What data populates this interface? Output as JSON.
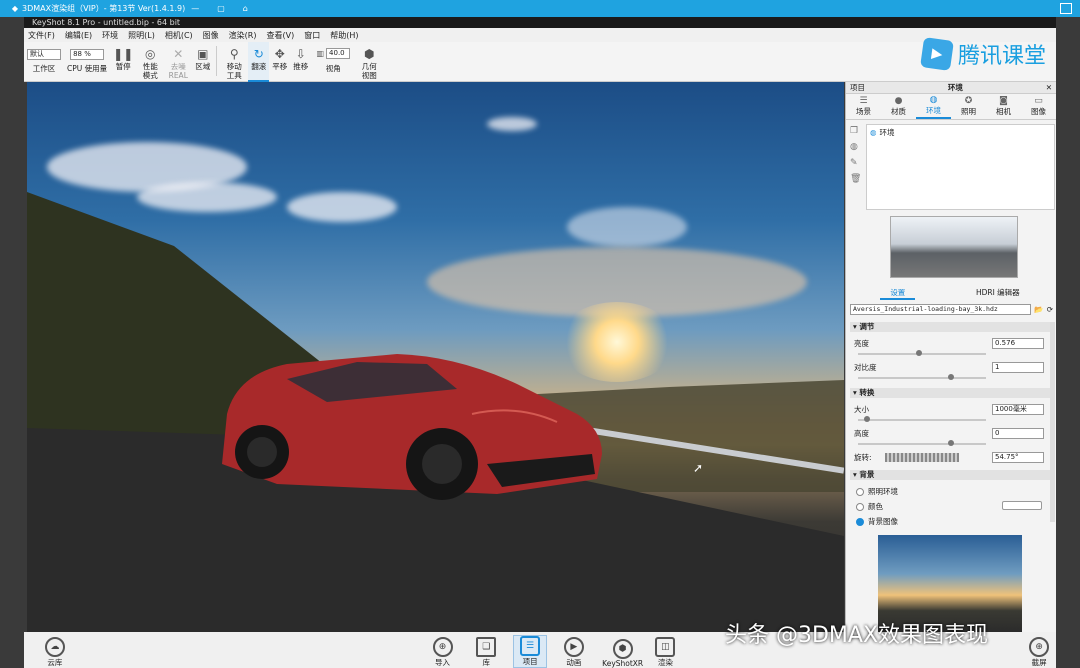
{
  "topstrip": {
    "title": "3DMAX渲染组（VIP）- 第13节 Ver(1.4.1.9)"
  },
  "window": {
    "title": "KeyShot 8.1 Pro - untitled.bip - 64 bit"
  },
  "menu": [
    "文件(F)",
    "编辑(E)",
    "环境",
    "照明(L)",
    "相机(C)",
    "图像",
    "渲染(R)",
    "查看(V)",
    "窗口",
    "帮助(H)"
  ],
  "toolbar": {
    "workspace_select": "默认",
    "workspace_label": "工作区",
    "cpu_select": "88 %",
    "cpu_label": "CPU 使用量",
    "pause": "暂停",
    "perf": "性能模式",
    "denoise": "去噪\nREAL",
    "region": "区域",
    "move_tool": "移动工具",
    "tumble": "翻滚",
    "pan": "平移",
    "dolly": "推移",
    "fov_value": "40.0",
    "fov_label": "视角",
    "geom": "几何视图"
  },
  "logo": {
    "text": "腾讯课堂"
  },
  "panel": {
    "left_title": "项目",
    "title": "环境",
    "tabs": [
      {
        "label": "场景",
        "icon": "list-icon"
      },
      {
        "label": "材质",
        "icon": "sphere-icon"
      },
      {
        "label": "环境",
        "icon": "globe-icon"
      },
      {
        "label": "照明",
        "icon": "bulb-icon"
      },
      {
        "label": "相机",
        "icon": "camera-icon"
      },
      {
        "label": "图像",
        "icon": "image-icon"
      }
    ],
    "env_item": "环境",
    "subtab_settings": "设置",
    "subtab_hdri": "HDRI 编辑器",
    "hdri_file": "Aversis_Industrial-loading-bay_3k.hdz",
    "sec_adjust": "调节",
    "brightness_label": "亮度",
    "brightness_value": "0.576",
    "brightness": 0.45,
    "contrast_label": "对比度",
    "contrast_value": "1",
    "contrast": 0.7,
    "sec_transform": "转换",
    "size_label": "大小",
    "size_value": "1000毫米",
    "size": 0.05,
    "height_label": "高度",
    "height_value": "0",
    "height": 0.7,
    "rotation_label": "旋转:",
    "rotation_value": "54.75°",
    "sec_background": "背景",
    "bg_options": [
      "照明环境",
      "颜色",
      "背景图像"
    ],
    "bg_selected": 2
  },
  "dock": [
    {
      "label": "云库",
      "icon": "cloud-icon"
    },
    {
      "label": "导入",
      "icon": "import-icon"
    },
    {
      "label": "库",
      "icon": "book-icon"
    },
    {
      "label": "项目",
      "icon": "project-icon"
    },
    {
      "label": "动画",
      "icon": "play-icon"
    },
    {
      "label": "KeyShotXR",
      "icon": "cube-icon"
    },
    {
      "label": "渲染",
      "icon": "render-icon"
    },
    {
      "label": "截屏",
      "icon": "screenshot-icon"
    }
  ],
  "watermark": "头条 @3DMAX效果图表现",
  "colors": {
    "accent": "#1a8bd8",
    "titlebar": "#1fa3e0",
    "car": "#b02a2a"
  }
}
